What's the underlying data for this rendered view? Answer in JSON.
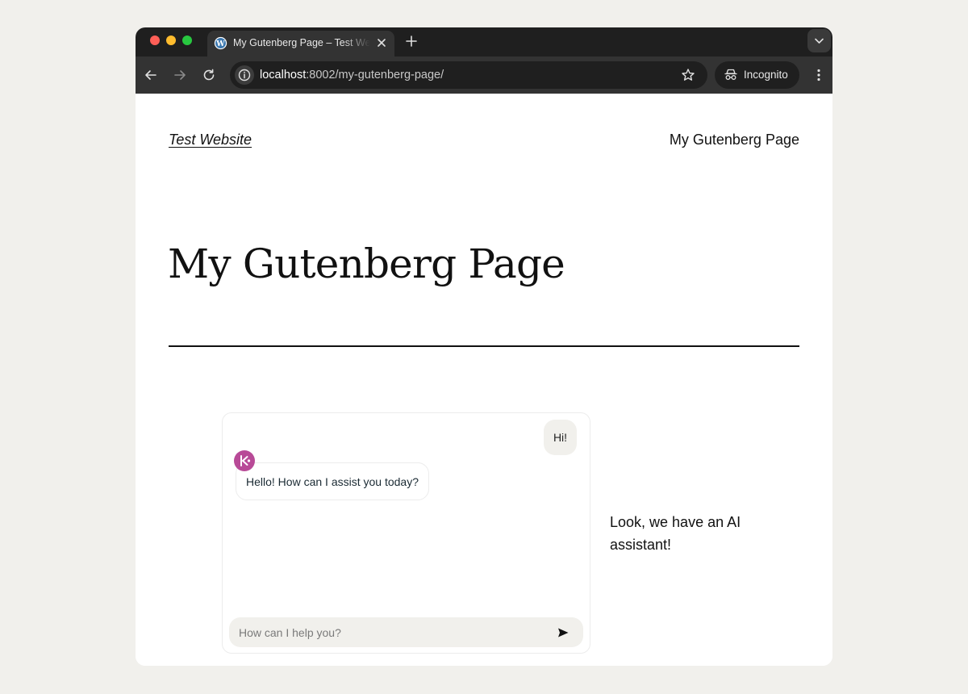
{
  "browser": {
    "tab_title": "My Gutenberg Page – Test Website",
    "url_host": "localhost",
    "url_rest": ":8002/my-gutenberg-page/",
    "incognito_label": "Incognito"
  },
  "site": {
    "title": "Test Website",
    "nav_link": "My Gutenberg Page"
  },
  "page": {
    "heading": "My Gutenberg Page",
    "side_text": "Look, we have an AI assistant!"
  },
  "chat": {
    "messages": [
      {
        "role": "user",
        "text": "Hi!"
      },
      {
        "role": "assistant",
        "text": "Hello! How can I assist you today?"
      }
    ],
    "input_placeholder": "How can I help you?"
  },
  "icons": {
    "tab_favicon": "wordpress-icon",
    "assistant_avatar": "assistant-logo-icon",
    "send": "send-icon"
  },
  "colors": {
    "assistant_avatar": "#b84a97",
    "user_bubble": "#f1f0ec",
    "page_background": "#f1f0ec"
  }
}
